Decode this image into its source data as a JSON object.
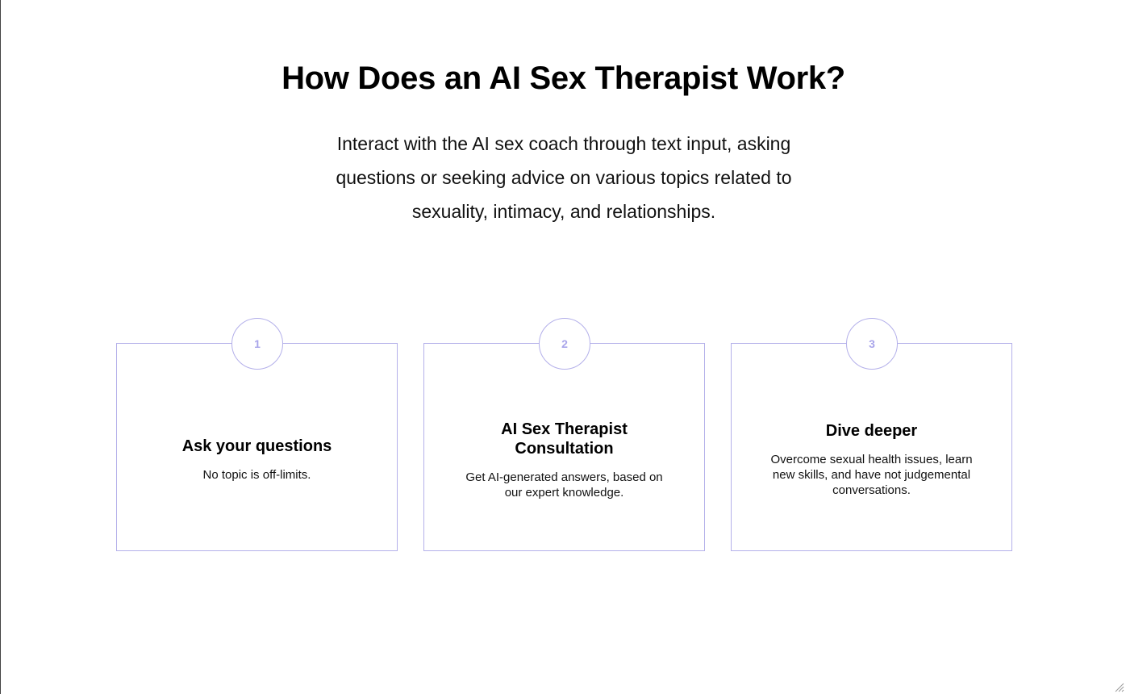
{
  "section": {
    "title": "How Does an AI Sex Therapist Work?",
    "subtitle": "Interact with the AI sex coach through text input, asking questions or seeking advice on various topics related to sexuality, intimacy, and relationships."
  },
  "steps": [
    {
      "number": "1",
      "title": "Ask your questions",
      "description": "No topic is off-limits."
    },
    {
      "number": "2",
      "title": "AI Sex Therapist Consultation",
      "description": "Get AI-generated answers, based on our expert knowledge."
    },
    {
      "number": "3",
      "title": "Dive deeper",
      "description": "Overcome sexual health issues, learn new skills, and have not judgemental conversations."
    }
  ],
  "colors": {
    "accent_border": "#b4b0ea",
    "accent_number": "#a9a5ea",
    "text": "#000000",
    "background": "#ffffff"
  },
  "icons": {
    "resize_grip": "resize-grip-icon"
  }
}
